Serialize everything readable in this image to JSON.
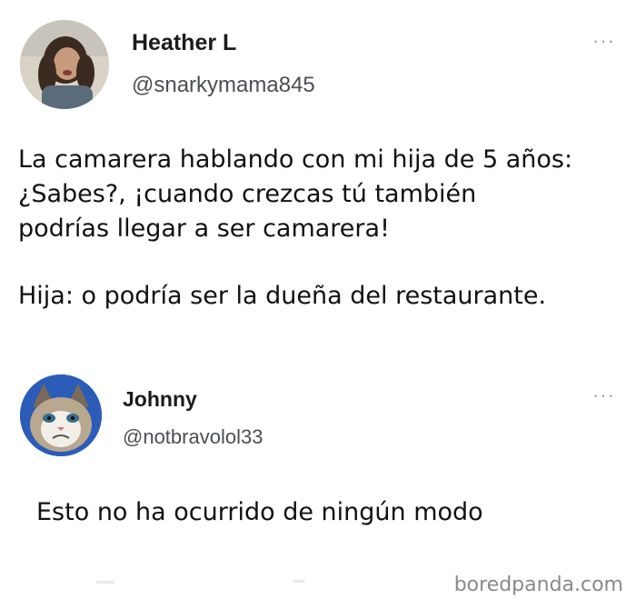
{
  "tweet": {
    "author_name": "Heather L",
    "author_handle": "@snarkymama845",
    "more_icon": "more-dots-icon",
    "lines": [
      "La camarera hablando con mi hija de 5 años:",
      "¿Sabes?, ¡cuando crezcas tú también",
      "podrías llegar a ser camarera!",
      "Hija: o podría ser la dueña del restaurante."
    ]
  },
  "reply": {
    "author_name": "Johnny",
    "author_handle": "@notbravolol33",
    "more_icon": "more-dots-icon",
    "text": "Esto no ha ocurrido de ningún modo"
  },
  "watermark": "boredpanda.com",
  "colors": {
    "text": "#111111",
    "handle": "#4a4f54",
    "dots": "#9aa0a6",
    "watermark": "#8a8a8a"
  }
}
